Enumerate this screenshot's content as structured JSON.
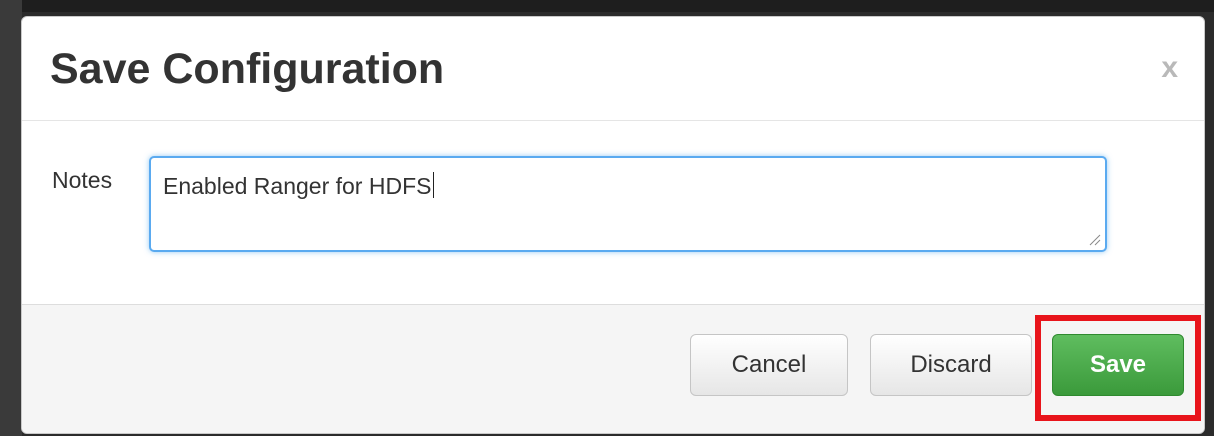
{
  "modal": {
    "title": "Save Configuration",
    "close_label": "x"
  },
  "form": {
    "notes_label": "Notes",
    "notes_value": "Enabled Ranger for HDFS"
  },
  "footer": {
    "cancel_label": "Cancel",
    "discard_label": "Discard",
    "save_label": "Save"
  },
  "colors": {
    "save_button": "#3b9a3b",
    "highlight": "#e8141b",
    "focus_border": "#5aaaf0"
  }
}
